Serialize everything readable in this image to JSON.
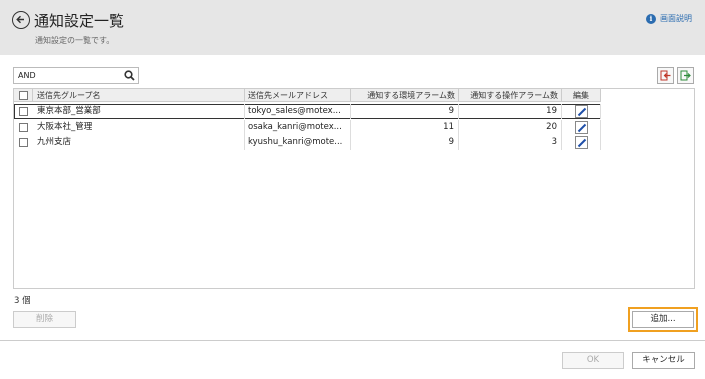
{
  "header": {
    "title": "通知設定一覧",
    "subtitle": "通知設定の一覧です。",
    "help_label": "画面説明"
  },
  "search": {
    "value": "AND",
    "placeholder": ""
  },
  "table": {
    "columns": [
      "送信先グループ名",
      "送信先メールアドレス",
      "通知する環境アラーム数",
      "通知する操作アラーム数",
      "編集"
    ],
    "rows": [
      {
        "group": "東京本部_営業部",
        "email": "tokyo_sales@motex...",
        "env_alarms": "9",
        "op_alarms": "19"
      },
      {
        "group": "大阪本社_管理",
        "email": "osaka_kanri@motex...",
        "env_alarms": "11",
        "op_alarms": "20"
      },
      {
        "group": "九州支店",
        "email": "kyushu_kanri@mote...",
        "env_alarms": "9",
        "op_alarms": "3"
      }
    ]
  },
  "footer": {
    "count_label": "3 個",
    "delete_label": "削除",
    "add_label": "追加...",
    "ok_label": "OK",
    "cancel_label": "キャンセル"
  },
  "colors": {
    "header_bg": "#e6e6e6",
    "accent_blue": "#2b6cb0",
    "highlight_orange": "#f0a020"
  },
  "icons": [
    "back-arrow-icon",
    "info-icon",
    "search-icon",
    "import-icon",
    "export-icon",
    "edit-pencil-icon"
  ]
}
